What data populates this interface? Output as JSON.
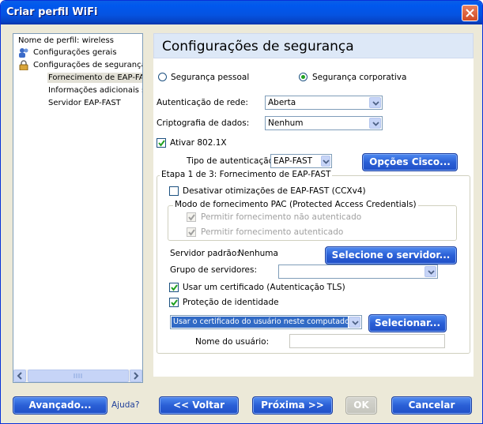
{
  "window": {
    "title": "Criar perfil WiFi"
  },
  "tree": {
    "items": [
      {
        "label": "Nome de perfil: wireless"
      },
      {
        "label": "Configurações gerais"
      },
      {
        "label": "Configurações de segurança"
      },
      {
        "label": "Fornecimento de EAP-FAST"
      },
      {
        "label": "Informações adicionais sobre"
      },
      {
        "label": "Servidor EAP-FAST"
      }
    ]
  },
  "pane": {
    "title": "Configurações de segurança",
    "radio_personal": "Segurança pessoal",
    "radio_corporate": "Segurança corporativa",
    "selected_security": "corporate",
    "auth_label": "Autenticação de rede:",
    "auth_value": "Aberta",
    "crypto_label": "Criptografia de dados:",
    "crypto_value": "Nenhum",
    "enable_8021x": "Ativar 802.1X",
    "auth_type_label": "Tipo de autenticação:",
    "auth_type_value": "EAP-FAST",
    "cisco_options_button": "Opções Cisco...",
    "step_group_title": "Etapa 1 de 3: Fornecimento de EAP-FAST",
    "disable_ccx": "Desativar otimizações de EAP-FAST (CCXv4)",
    "pac_group_title": "Modo de fornecimento PAC (Protected Access Credentials)",
    "allow_unauth": "Permitir fornecimento não autenticado",
    "allow_auth": "Permitir fornecimento autenticado",
    "default_server_label": "Servidor padrão:",
    "default_server_value": "Nenhuma",
    "select_server_button": "Selecione o servidor...",
    "server_group_label": "Grupo de servidores:",
    "server_group_value": "",
    "use_certificate": "Usar um certificado (Autenticação TLS)",
    "identity_protection": "Proteção de identidade",
    "certificate_combo_value": "Usar o certificado do usuário neste computador",
    "select_button": "Selecionar...",
    "username_label": "Nome do usuário:",
    "username_value": ""
  },
  "footer": {
    "advanced_button": "Avançado...",
    "help_link": "Ajuda?",
    "back_button": "<< Voltar",
    "next_button": "Próxima >>",
    "ok_button": "OK",
    "cancel_button": "Cancelar"
  },
  "colors": {
    "title_bar": "#0058ee",
    "dialog_bg": "#ece9d8",
    "pane_header": "#dde8f7",
    "button_blue": "#2a5fd6",
    "selection": "#316ac5"
  }
}
